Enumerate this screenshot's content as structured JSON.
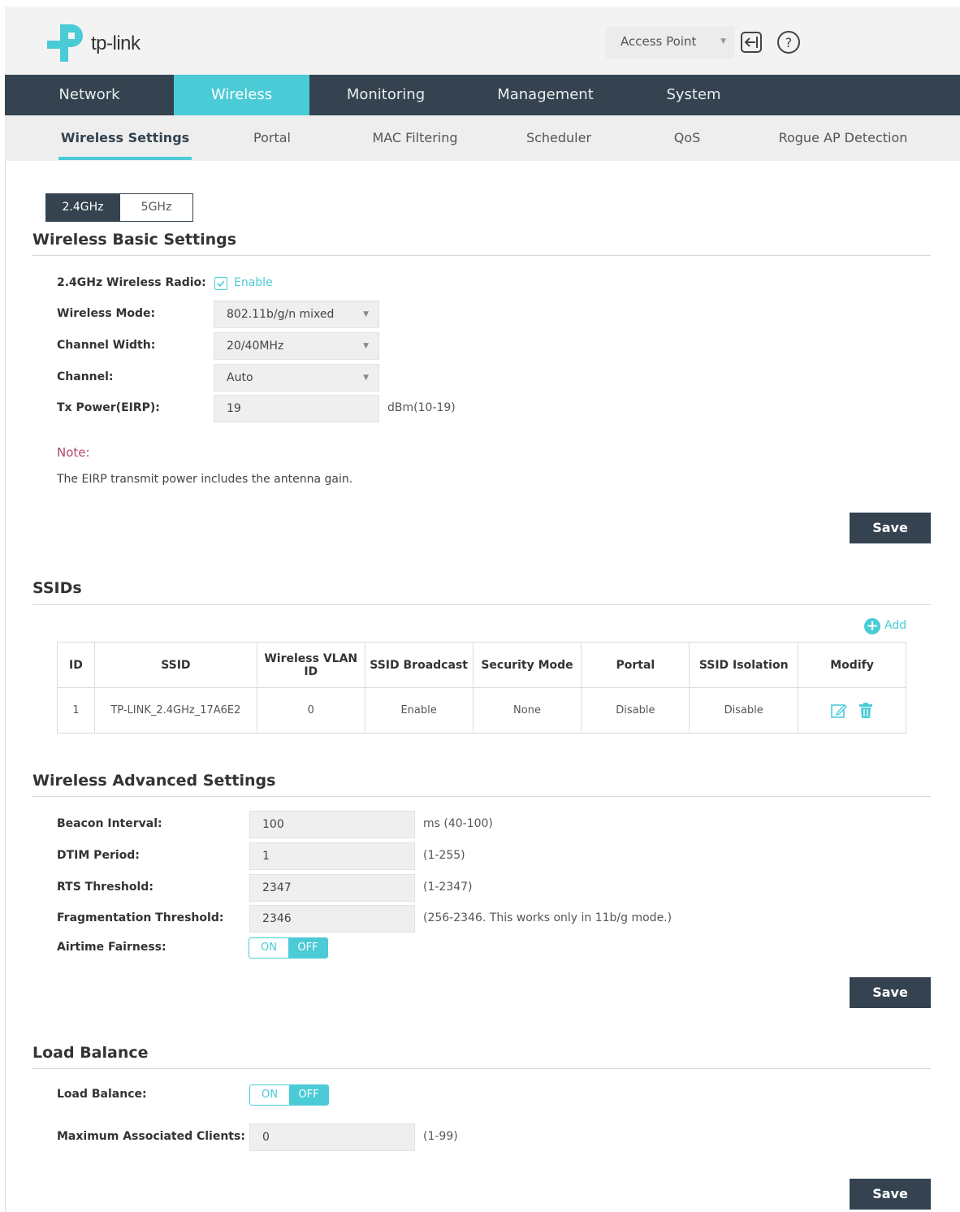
{
  "header": {
    "brand": "tp-link",
    "mode_select": "Access Point"
  },
  "nav": {
    "items": [
      "Network",
      "Wireless",
      "Monitoring",
      "Management",
      "System"
    ],
    "active": "Wireless"
  },
  "subnav": {
    "items": [
      "Wireless Settings",
      "Portal",
      "MAC Filtering",
      "Scheduler",
      "QoS",
      "Rogue AP Detection"
    ],
    "active": "Wireless Settings"
  },
  "bands": {
    "band1": "2.4GHz",
    "band2": "5GHz",
    "active": "2.4GHz"
  },
  "basic": {
    "title": "Wireless Basic Settings",
    "radio_label": "2.4GHz Wireless Radio:",
    "radio_enable": "Enable",
    "mode_label": "Wireless Mode:",
    "mode_value": "802.11b/g/n mixed",
    "width_label": "Channel Width:",
    "width_value": "20/40MHz",
    "channel_label": "Channel:",
    "channel_value": "Auto",
    "tx_label": "Tx Power(EIRP):",
    "tx_value": "19",
    "tx_hint": "dBm(10-19)",
    "note_title": "Note:",
    "note_text": "The EIRP transmit power includes the antenna gain.",
    "save": "Save"
  },
  "ssids": {
    "title": "SSIDs",
    "add": "Add",
    "columns": [
      "ID",
      "SSID",
      "Wireless VLAN ID",
      "SSID Broadcast",
      "Security Mode",
      "Portal",
      "SSID Isolation",
      "Modify"
    ],
    "rows": [
      {
        "id": "1",
        "ssid": "TP-LINK_2.4GHz_17A6E2",
        "vlan": "0",
        "broadcast": "Enable",
        "security": "None",
        "portal": "Disable",
        "isolation": "Disable"
      }
    ]
  },
  "advanced": {
    "title": "Wireless Advanced Settings",
    "beacon_label": "Beacon Interval:",
    "beacon_value": "100",
    "beacon_hint": "ms (40-100)",
    "dtim_label": "DTIM Period:",
    "dtim_value": "1",
    "dtim_hint": "(1-255)",
    "rts_label": "RTS Threshold:",
    "rts_value": "2347",
    "rts_hint": "(1-2347)",
    "frag_label": "Fragmentation Threshold:",
    "frag_value": "2346",
    "frag_hint": "(256-2346. This works only in 11b/g mode.)",
    "airtime_label": "Airtime Fairness:",
    "toggle_on": "ON",
    "toggle_off": "OFF",
    "airtime_state": "OFF",
    "save": "Save"
  },
  "load_balance": {
    "title": "Load Balance",
    "lb_label": "Load Balance:",
    "lb_state": "OFF",
    "toggle_on": "ON",
    "toggle_off": "OFF",
    "max_label": "Maximum Associated Clients:",
    "max_value": "0",
    "max_hint": "(1-99)",
    "save": "Save"
  },
  "colors": {
    "nav_bg": "#34434f",
    "accent": "#4acbd6",
    "note": "#b04a6a"
  }
}
